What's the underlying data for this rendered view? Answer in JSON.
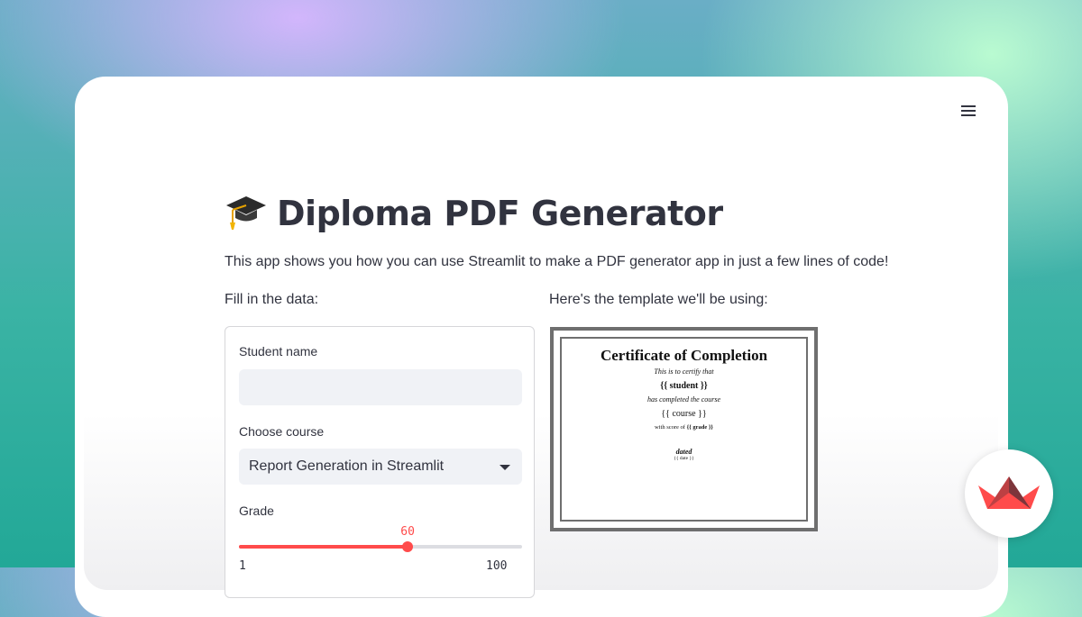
{
  "app": {
    "title": "Diploma PDF Generator",
    "title_icon": "graduation-cap-icon",
    "intro": "This app shows you how you can use Streamlit to make a PDF generator app in just a few lines of code!",
    "menu_icon": "hamburger-menu-icon"
  },
  "form": {
    "heading": "Fill in the data:",
    "student_label": "Student name",
    "student_value": "",
    "course_label": "Choose course",
    "course_value": "Report Generation in Streamlit",
    "grade_label": "Grade",
    "grade_value": 60,
    "grade_value_text": "60",
    "grade_min": "1",
    "grade_max": "100"
  },
  "template": {
    "heading": "Here's the template we'll be using:",
    "cert_title": "Certificate of Completion",
    "certify": "This is to certify that",
    "student": "{{ student }}",
    "completed": "has completed the course",
    "course": "{{ course }}",
    "score_prefix": "with score of",
    "score": "{{ grade }}",
    "dated": "dated",
    "date": "{{ date }}"
  },
  "colors": {
    "accent": "#ff4b4b",
    "text": "#31333f",
    "input_bg": "#f0f2f6"
  },
  "brand": {
    "logo_icon": "streamlit-logo-icon"
  }
}
